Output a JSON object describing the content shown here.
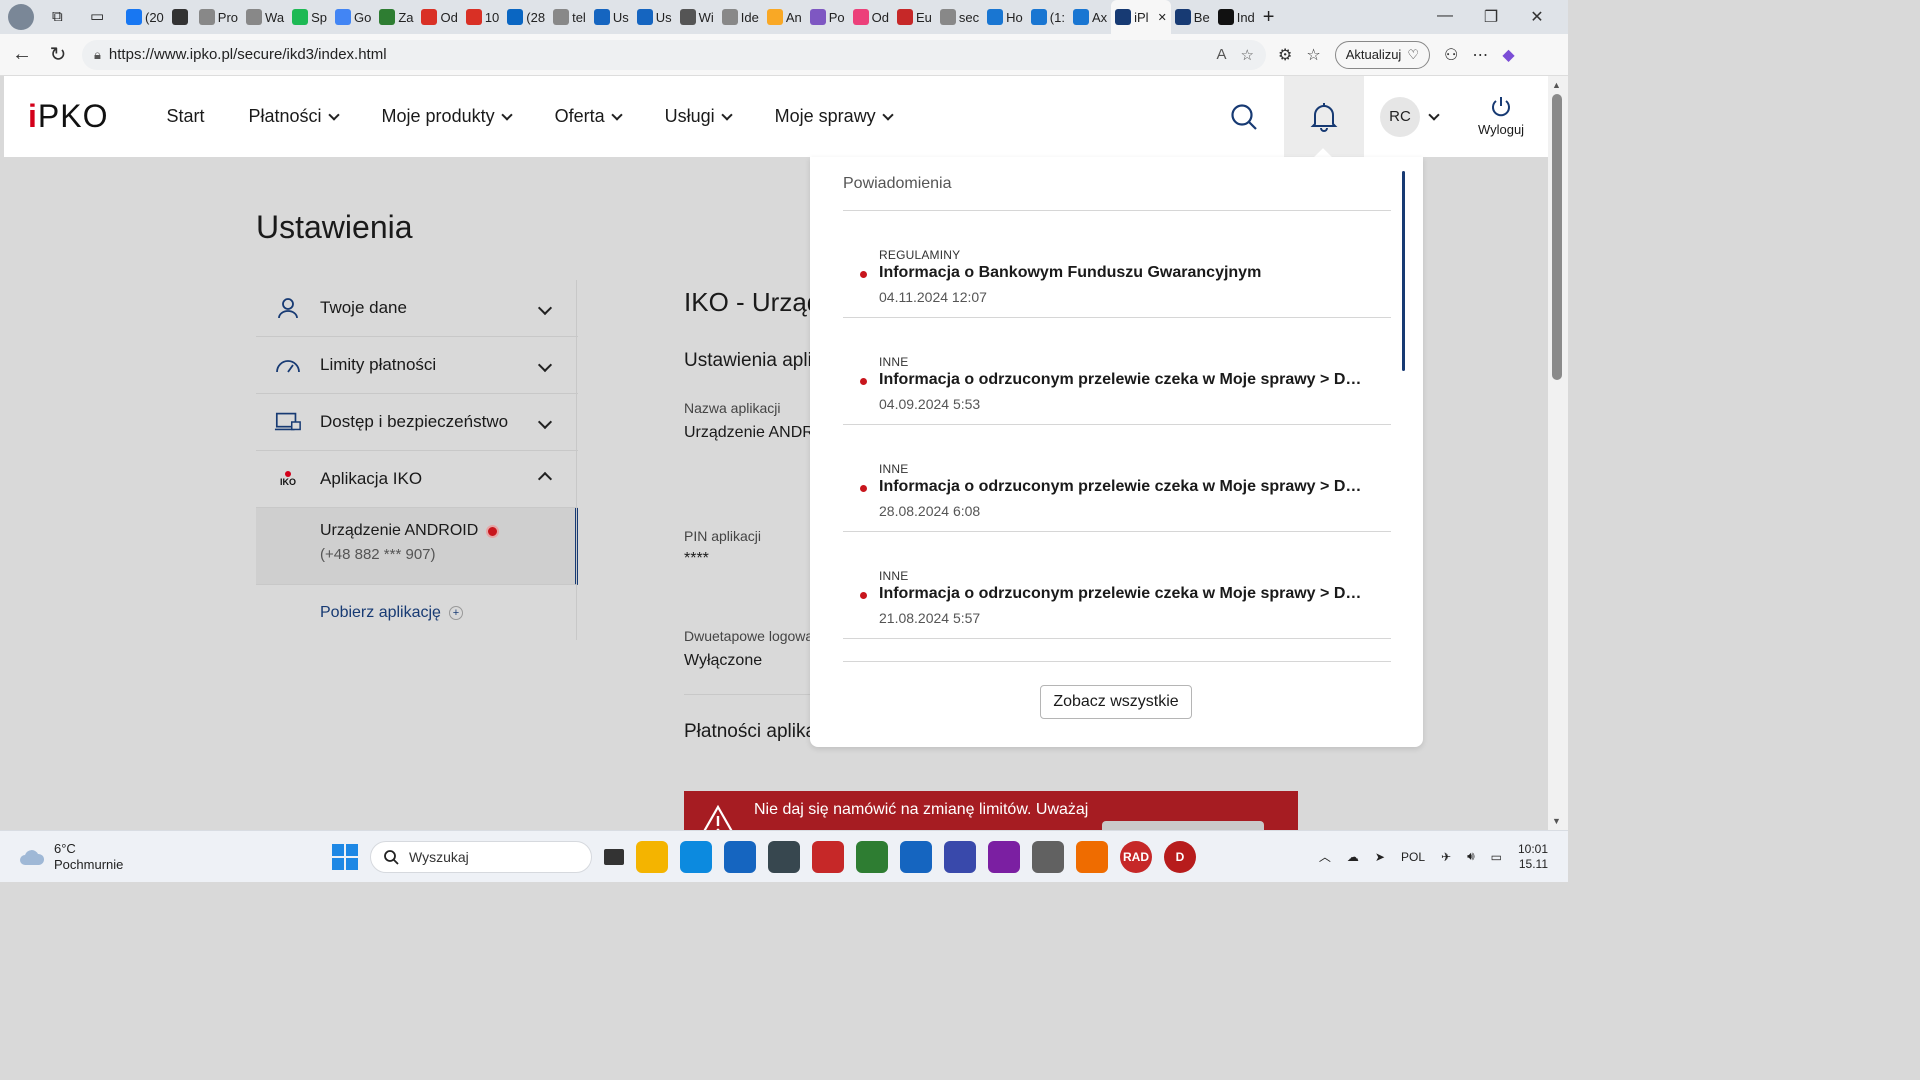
{
  "browser": {
    "tabs": [
      {
        "label": "(20",
        "icon": "facebook-icon",
        "color": "#1877f2"
      },
      {
        "label": "",
        "icon": "gn-icon",
        "color": "#333333"
      },
      {
        "label": "Pro",
        "icon": "generic-icon",
        "color": "#888888"
      },
      {
        "label": "Wa",
        "icon": "generic-icon",
        "color": "#888888"
      },
      {
        "label": "Sp",
        "icon": "spotify-icon",
        "color": "#1db954"
      },
      {
        "label": "Go",
        "icon": "google-icon",
        "color": "#4285f4"
      },
      {
        "label": "Za",
        "icon": "generic-icon",
        "color": "#2e7d32"
      },
      {
        "label": "Od",
        "icon": "gmail-icon",
        "color": "#d93025"
      },
      {
        "label": "10",
        "icon": "gmail-icon",
        "color": "#d93025"
      },
      {
        "label": "(28",
        "icon": "linkedin-icon",
        "color": "#0a66c2"
      },
      {
        "label": "tel",
        "icon": "search-icon",
        "color": "#888888"
      },
      {
        "label": "Us",
        "icon": "eli-icon",
        "color": "#1565c0"
      },
      {
        "label": "Us",
        "icon": "eli-icon",
        "color": "#1565c0"
      },
      {
        "label": "Wi",
        "icon": "wikipedia-icon",
        "color": "#555555"
      },
      {
        "label": "Ide",
        "icon": "generic-icon",
        "color": "#888888"
      },
      {
        "label": "An",
        "icon": "chart-icon",
        "color": "#f9a825"
      },
      {
        "label": "Po",
        "icon": "generic-icon",
        "color": "#7e57c2"
      },
      {
        "label": "Od",
        "icon": "generic-icon",
        "color": "#ec407a"
      },
      {
        "label": "Eu",
        "icon": "generic-icon",
        "color": "#c62828"
      },
      {
        "label": "sec",
        "icon": "search-icon",
        "color": "#888888"
      },
      {
        "label": "Ho",
        "icon": "at-icon",
        "color": "#1976d2"
      },
      {
        "label": "(1:",
        "icon": "mail-icon",
        "color": "#1976d2"
      },
      {
        "label": "Ax",
        "icon": "at-icon",
        "color": "#1976d2"
      },
      {
        "label": "iPl",
        "icon": "pko-icon",
        "color": "#173a73",
        "active": true
      },
      {
        "label": "Be",
        "icon": "generic-icon",
        "color": "#173a73"
      },
      {
        "label": "Ind",
        "icon": "gn-icon",
        "color": "#111111"
      }
    ],
    "url": "https://www.ipko.pl/secure/ikd3/index.html",
    "update_label": "Aktualizuj"
  },
  "nav": {
    "logo_prefix": "i",
    "logo_text": "PKO",
    "menu": [
      {
        "label": "Start",
        "dropdown": false
      },
      {
        "label": "Płatności",
        "dropdown": true
      },
      {
        "label": "Moje produkty",
        "dropdown": true
      },
      {
        "label": "Oferta",
        "dropdown": true
      },
      {
        "label": "Usługi",
        "dropdown": true
      },
      {
        "label": "Moje sprawy",
        "dropdown": true
      }
    ],
    "user_initials": "RC",
    "logout_label": "Wyloguj"
  },
  "settings": {
    "title": "Ustawienia",
    "menu": [
      {
        "label": "Twoje dane",
        "icon": "user-icon"
      },
      {
        "label": "Limity płatności",
        "icon": "speedometer-icon"
      },
      {
        "label": "Dostęp i bezpieczeństwo",
        "icon": "laptop-lock-icon"
      },
      {
        "label": "Aplikacja IKO",
        "icon": "iko-icon",
        "icon_text": "IKO"
      }
    ],
    "device_name": "Urządzenie ANDROID",
    "device_phone": "(+48 882 *** 907)",
    "download_label": "Pobierz aplikację"
  },
  "main": {
    "title": "IKO - Urząd",
    "subheading": "Ustawienia apli",
    "app_name_label": "Nazwa aplikacji",
    "app_name_value": "Urządzenie ANDRO",
    "pin_label": "PIN aplikacji",
    "pin_value": "****",
    "twostep_label": "Dwuetapowe logowa",
    "twostep_value": "Wyłączone",
    "payments_heading": "Płatności aplikacją",
    "alert_text": "Nie daj się namówić na zmianę limitów. Uważaj"
  },
  "notifications": {
    "heading": "Powiadomienia",
    "items": [
      {
        "category": "REGULAMINY",
        "title": "Informacja o Bankowym Funduszu Gwarancyjnym",
        "date": "04.11.2024 12:07"
      },
      {
        "category": "INNE",
        "title": "Informacja o odrzuconym przelewie czeka w Moje sprawy > Doku...",
        "date": "04.09.2024 5:53"
      },
      {
        "category": "INNE",
        "title": "Informacja o odrzuconym przelewie czeka w Moje sprawy > Doku...",
        "date": "28.08.2024 6:08"
      },
      {
        "category": "INNE",
        "title": "Informacja o odrzuconym przelewie czeka w Moje sprawy > Doku...",
        "date": "21.08.2024 5:57"
      }
    ],
    "see_all_label": "Zobacz wszystkie"
  },
  "taskbar": {
    "temperature": "6°C",
    "weather": "Pochmurnie",
    "search_placeholder": "Wyszukaj",
    "apps": [
      {
        "name": "file-explorer-icon",
        "color": "#f4b400"
      },
      {
        "name": "edge-icon",
        "color": "#0c8adf"
      },
      {
        "name": "store-icon",
        "color": "#1565c0"
      },
      {
        "name": "box-icon",
        "color": "#37474f"
      },
      {
        "name": "media-icon",
        "color": "#c62828"
      },
      {
        "name": "globe-icon",
        "color": "#2e7d32"
      },
      {
        "name": "network-icon",
        "color": "#1565c0"
      },
      {
        "name": "save-icon",
        "color": "#3949ab"
      },
      {
        "name": "github-icon",
        "color": "#7b1fa2"
      },
      {
        "name": "drive-icon",
        "color": "#616161"
      },
      {
        "name": "vlc-icon",
        "color": "#ef6c00"
      },
      {
        "name": "radio-icon",
        "color": "#c62828",
        "text": "RAD"
      },
      {
        "name": "d-icon",
        "color": "#b71c1c",
        "text": "D"
      }
    ],
    "language": "POL",
    "time": "10:01",
    "date": "15.11"
  },
  "colors": {
    "brand_navy": "#173a73",
    "brand_red": "#d3001a",
    "alert_red": "#a61c22"
  }
}
